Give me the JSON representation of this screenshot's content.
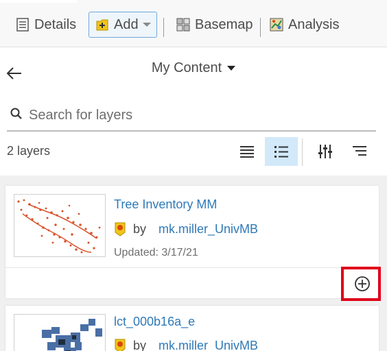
{
  "toolbar": {
    "details_label": "Details",
    "add_label": "Add",
    "basemap_label": "Basemap",
    "analysis_label": "Analysis"
  },
  "panel": {
    "title": "My Content"
  },
  "search": {
    "placeholder": "Search for layers"
  },
  "list": {
    "count_label": "2 layers",
    "items": [
      {
        "title": "Tree Inventory MM",
        "by": "by",
        "owner": "mk.miller_UnivMB",
        "updated": "Updated: 3/17/21"
      },
      {
        "title": "lct_000b16a_e",
        "by": "by",
        "owner": "mk.miller_UnivMB"
      }
    ]
  },
  "colors": {
    "link": "#2e7ab7",
    "highlight": "#e0001a",
    "active_view": "#d2e9f9"
  }
}
